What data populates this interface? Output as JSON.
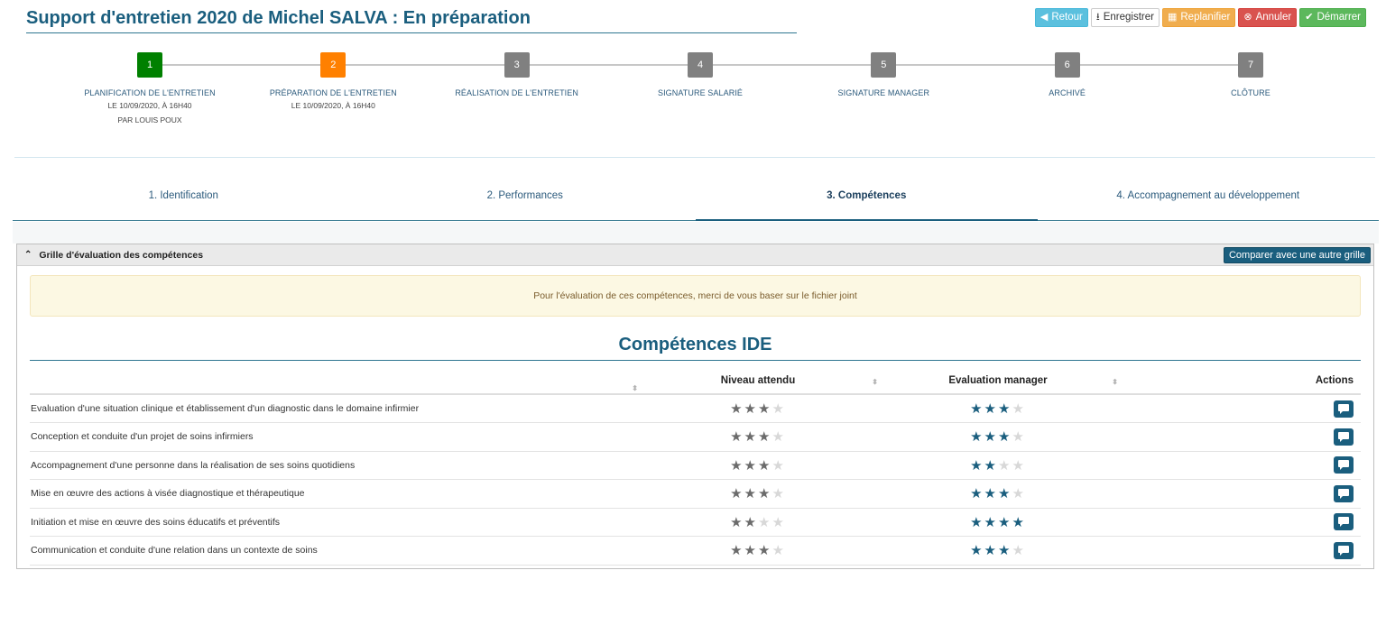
{
  "header": {
    "title": "Support d'entretien 2020 de Michel SALVA : En préparation",
    "buttons": {
      "retour": "Retour",
      "enregistrer": "Enregistrer",
      "replanifier": "Replanifier",
      "annuler": "Annuler",
      "demarrer": "Démarrer"
    }
  },
  "steps": [
    {
      "number": "1",
      "label": "Planification de l'entretien",
      "sub1": "le 10/09/2020, à 16h40",
      "sub2": "par Louis POUX",
      "color": "#008000"
    },
    {
      "number": "2",
      "label": "Préparation de l'entretien",
      "sub1": "le 10/09/2020, à 16h40",
      "sub2": "",
      "color": "#ff8000"
    },
    {
      "number": "3",
      "label": "Réalisation de l'entretien",
      "sub1": "",
      "sub2": "",
      "color": "#808080"
    },
    {
      "number": "4",
      "label": "Signature salarié",
      "sub1": "",
      "sub2": "",
      "color": "#808080"
    },
    {
      "number": "5",
      "label": "Signature manager",
      "sub1": "",
      "sub2": "",
      "color": "#808080"
    },
    {
      "number": "6",
      "label": "Archivé",
      "sub1": "",
      "sub2": "",
      "color": "#808080"
    },
    {
      "number": "7",
      "label": "Clôture",
      "sub1": "",
      "sub2": "",
      "color": "#808080"
    }
  ],
  "tabs": [
    {
      "label": "1. Identification"
    },
    {
      "label": "2. Performances"
    },
    {
      "label": "3. Compétences"
    },
    {
      "label": "4. Accompagnement au développement"
    }
  ],
  "panel": {
    "title": "Grille d'évaluation des compétences",
    "compare_button": "Comparer avec une autre grille",
    "alert": "Pour l'évaluation de ces compétences, merci de vous baser sur le fichier joint",
    "section_title": "Compétences IDE",
    "columns": {
      "niveau": "Niveau attendu",
      "evaluation": "Evaluation manager",
      "actions": "Actions"
    },
    "rows": [
      {
        "label": "Evaluation d'une situation clinique et établissement d'un diagnostic dans le domaine infirmier",
        "niveau": 3,
        "evaluation": 3
      },
      {
        "label": "Conception et conduite d'un projet de soins infirmiers",
        "niveau": 3,
        "evaluation": 3
      },
      {
        "label": "Accompagnement d'une personne dans la réalisation de ses soins quotidiens",
        "niveau": 3,
        "evaluation": 2
      },
      {
        "label": "Mise en œuvre des actions à visée diagnostique et thérapeutique",
        "niveau": 3,
        "evaluation": 3
      },
      {
        "label": "Initiation et mise en œuvre des soins éducatifs et préventifs",
        "niveau": 2,
        "evaluation": 4
      },
      {
        "label": "Communication et conduite d'une relation dans un contexte de soins",
        "niveau": 3,
        "evaluation": 3
      }
    ],
    "max_stars": 4
  }
}
